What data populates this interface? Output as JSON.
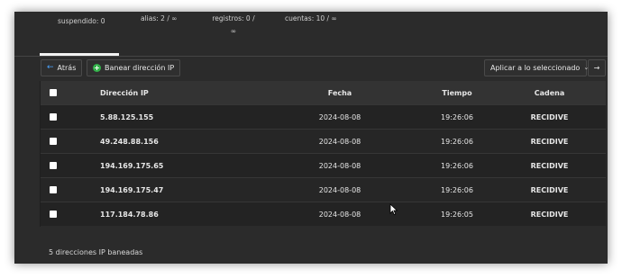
{
  "stats": {
    "suspended": "suspendido: 0",
    "alias": "alias: 2 / ∞",
    "records_line1": "registros: 0 /",
    "records_line2": "∞",
    "accounts": "cuentas: 10 / ∞"
  },
  "toolbar": {
    "back_label": "Atrás",
    "ban_label": "Banear dirección IP",
    "bulk_action_selected": "Aplicar a lo seleccionado",
    "go_symbol": "→"
  },
  "table": {
    "headers": [
      "Dirección IP",
      "Fecha",
      "Tiempo",
      "Cadena"
    ],
    "rows": [
      {
        "ip": "5.88.125.155",
        "date": "2024-08-08",
        "time": "19:26:06",
        "chain": "RECIDIVE"
      },
      {
        "ip": "49.248.88.156",
        "date": "2024-08-08",
        "time": "19:26:06",
        "chain": "RECIDIVE"
      },
      {
        "ip": "194.169.175.65",
        "date": "2024-08-08",
        "time": "19:26:06",
        "chain": "RECIDIVE"
      },
      {
        "ip": "194.169.175.47",
        "date": "2024-08-08",
        "time": "19:26:06",
        "chain": "RECIDIVE"
      },
      {
        "ip": "117.184.78.86",
        "date": "2024-08-08",
        "time": "19:26:05",
        "chain": "RECIDIVE"
      }
    ]
  },
  "footer": {
    "count_text": "5 direcciones IP baneadas"
  },
  "colors": {
    "background": "#2b2b2b",
    "accent_blue": "#4aa3ff",
    "accent_green": "#33b24a"
  },
  "icons": {
    "back": "arrow-left-icon",
    "ban": "plus-circle-icon",
    "dropdown": "chevron-down-icon",
    "go": "arrow-right-icon",
    "cursor": "mouse-pointer-icon"
  }
}
